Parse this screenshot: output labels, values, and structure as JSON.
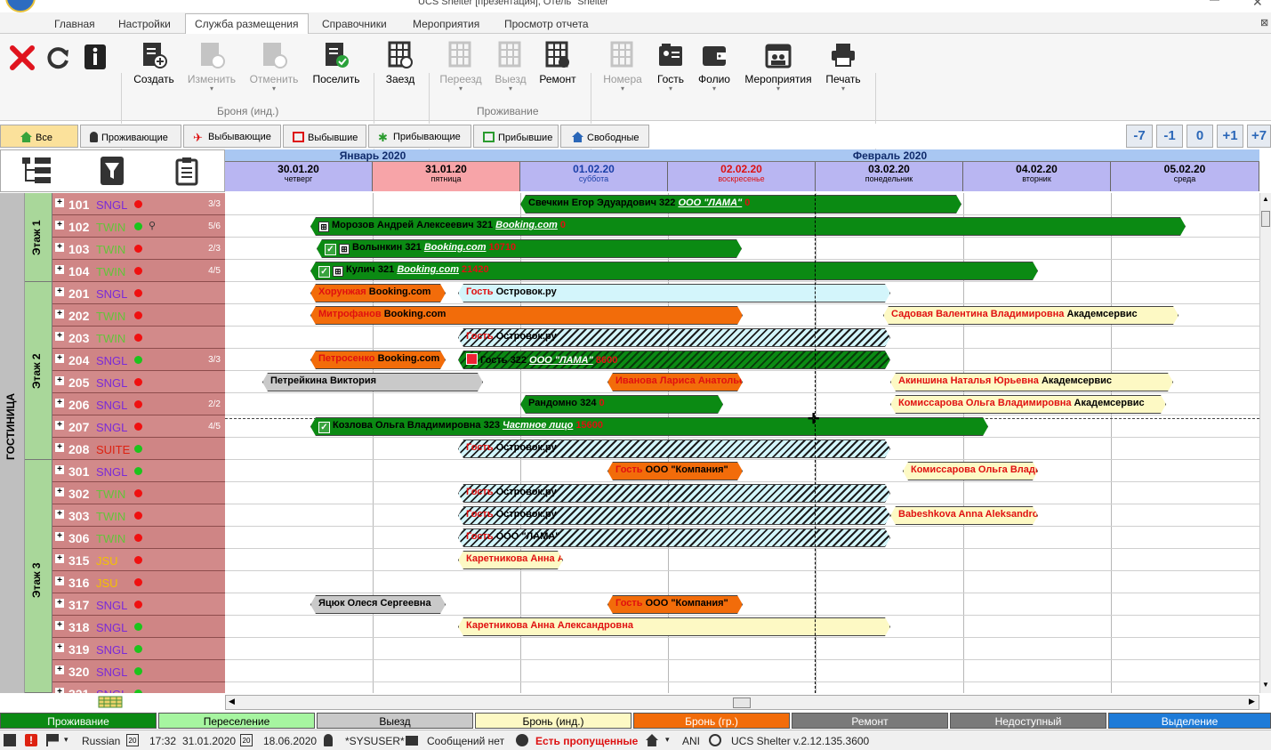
{
  "window": {
    "title": "UCS Shelter [презентация], Отель \"Shelter\""
  },
  "menu": {
    "items": [
      "Главная",
      "Настройки",
      "Служба размещения",
      "Справочники",
      "Мероприятия",
      "Просмотр отчета"
    ]
  },
  "ribbon": {
    "buttons": {
      "create": "Создать",
      "edit": "Изменить",
      "cancel": "Отменить",
      "settle": "Поселить",
      "checkin": "Заезд",
      "move": "Переезд",
      "checkout": "Выезд",
      "repair": "Ремонт",
      "rooms": "Номера",
      "guest": "Гость",
      "folio": "Фолио",
      "events": "Мероприятия",
      "print": "Печать"
    },
    "groups": {
      "booking": "Броня (инд.)",
      "living": "Проживание"
    }
  },
  "filters": {
    "all": "Все",
    "living": "Проживающие",
    "departing": "Выбывающие",
    "departed": "Выбывшие",
    "arriving": "Прибывающие",
    "arrived": "Прибывшие",
    "free": "Свободные"
  },
  "nav": [
    "-7",
    "-1",
    "0",
    "+1",
    "+7"
  ],
  "calendar": {
    "months": [
      "Январь 2020",
      "Февраль 2020"
    ],
    "days": [
      {
        "date": "30.01.20",
        "weekday": "четверг"
      },
      {
        "date": "31.01.20",
        "weekday": "пятница"
      },
      {
        "date": "01.02.20",
        "weekday": "суббота"
      },
      {
        "date": "02.02.20",
        "weekday": "воскресенье"
      },
      {
        "date": "03.02.20",
        "weekday": "понедельник"
      },
      {
        "date": "04.02.20",
        "weekday": "вторник"
      },
      {
        "date": "05.02.20",
        "weekday": "среда"
      }
    ]
  },
  "hotel": {
    "label": "ГОСТИНИЦА",
    "floors": [
      "Этаж 1",
      "Этаж 2",
      "Этаж 3"
    ]
  },
  "rooms": [
    {
      "num": "101",
      "type": "SNGL",
      "status": "red",
      "occ": "3/3"
    },
    {
      "num": "102",
      "type": "TWIN",
      "status": "green",
      "occ": "5/6"
    },
    {
      "num": "103",
      "type": "TWIN",
      "status": "red",
      "occ": "2/3"
    },
    {
      "num": "104",
      "type": "TWIN",
      "status": "red",
      "occ": "4/5"
    },
    {
      "num": "201",
      "type": "SNGL",
      "status": "red",
      "occ": ""
    },
    {
      "num": "202",
      "type": "TWIN",
      "status": "red",
      "occ": ""
    },
    {
      "num": "203",
      "type": "TWIN",
      "status": "red",
      "occ": ""
    },
    {
      "num": "204",
      "type": "SNGL",
      "status": "green",
      "occ": "3/3"
    },
    {
      "num": "205",
      "type": "SNGL",
      "status": "red",
      "occ": ""
    },
    {
      "num": "206",
      "type": "SNGL",
      "status": "red",
      "occ": "2/2"
    },
    {
      "num": "207",
      "type": "SNGL",
      "status": "red",
      "occ": "4/5"
    },
    {
      "num": "208",
      "type": "SUITE",
      "status": "green",
      "occ": ""
    },
    {
      "num": "301",
      "type": "SNGL",
      "status": "green",
      "occ": ""
    },
    {
      "num": "302",
      "type": "TWIN",
      "status": "red",
      "occ": ""
    },
    {
      "num": "303",
      "type": "TWIN",
      "status": "red",
      "occ": ""
    },
    {
      "num": "306",
      "type": "TWIN",
      "status": "red",
      "occ": ""
    },
    {
      "num": "315",
      "type": "JSU",
      "status": "red",
      "occ": ""
    },
    {
      "num": "316",
      "type": "JSU",
      "status": "red",
      "occ": ""
    },
    {
      "num": "317",
      "type": "SNGL",
      "status": "red",
      "occ": ""
    },
    {
      "num": "318",
      "type": "SNGL",
      "status": "green",
      "occ": ""
    },
    {
      "num": "319",
      "type": "SNGL",
      "status": "green",
      "occ": ""
    },
    {
      "num": "320",
      "type": "SNGL",
      "status": "green",
      "occ": ""
    },
    {
      "num": "321",
      "type": "SNGL",
      "status": "green",
      "occ": ""
    }
  ],
  "bookings": {
    "b101": {
      "name": "Свечкин Егор Эдуардович",
      "room": "322",
      "org": "ООО \"ЛАМА\"",
      "amount": "0"
    },
    "b102": {
      "name": "Морозов Андрей Алексеевич",
      "room": "321",
      "org": "Booking.com",
      "amount": "0"
    },
    "b103": {
      "name": "Волынкин",
      "room": "321",
      "org": "Booking.com",
      "amount": "10710"
    },
    "b104": {
      "name": "Кулич",
      "room": "321",
      "org": "Booking.com",
      "amount": "21420"
    },
    "b201a": {
      "name": "Хорунжая",
      "org": "Booking.com"
    },
    "b201b": {
      "name": "Гость",
      "org": "Островок.ру"
    },
    "b202a": {
      "name": "Митрофанов",
      "org": "Booking.com"
    },
    "b202b": {
      "name": "Садовая Валентина Владимировна",
      "org": "Академсервис"
    },
    "b203": {
      "name": "Гость",
      "org": "Островок.ру"
    },
    "b204a": {
      "name": "Петросенко",
      "org": "Booking.com"
    },
    "b204b": {
      "name": "Гость",
      "room": "322",
      "org": "ООО \"ЛАМА\"",
      "amount": "8600"
    },
    "b205a": {
      "name": "Петрейкина Виктория"
    },
    "b205b": {
      "name": "Иванова Лариса Анатольевна"
    },
    "b205c": {
      "name": "Акиншина Наталья Юрьевна",
      "org": "Академсервис"
    },
    "b206a": {
      "name": "Рандомно",
      "room": "324",
      "amount": "0"
    },
    "b206b": {
      "name": "Комиссарова Ольга Владимировна",
      "org": "Академсервис"
    },
    "b207": {
      "name": "Козлова Ольга Владимировна",
      "room": "323",
      "org": "Частное лицо",
      "amount": "15600"
    },
    "b208": {
      "name": "Гость",
      "org": "Островок.ру"
    },
    "b301a": {
      "name": "Гость",
      "org": "ООО \"Компания\""
    },
    "b301b": {
      "name": "Комиссарова Ольга Владимировна"
    },
    "b302": {
      "name": "Гость",
      "org": "Островок.ру"
    },
    "b303a": {
      "name": "Гость",
      "org": "Островок.ру"
    },
    "b303b": {
      "name": "Babeshkova Anna Aleksandrovna"
    },
    "b306": {
      "name": "Гость",
      "org": "ООО \"ЛАМА\""
    },
    "b315": {
      "name": "Каретникова  Анна Александровна"
    },
    "b317a": {
      "name": "Яцюк Олеся Сергеевна"
    },
    "b317b": {
      "name": "Гость",
      "org": "ООО \"Компания\""
    },
    "b318": {
      "name": "Каретникова  Анна Александровна"
    }
  },
  "legend": [
    {
      "label": "Проживание",
      "bg": "#0b8a13",
      "fg": "#ffffff"
    },
    {
      "label": "Переселение",
      "bg": "#a6f5a0",
      "fg": "#000000"
    },
    {
      "label": "Выезд",
      "bg": "#c9c9c9",
      "fg": "#000000"
    },
    {
      "label": "Бронь (инд.)",
      "bg": "#fdf9c4",
      "fg": "#000000"
    },
    {
      "label": "Бронь (гр.)",
      "bg": "#f26c0a",
      "fg": "#ffffff"
    },
    {
      "label": "Ремонт",
      "bg": "#7a7a7a",
      "fg": "#ffffff"
    },
    {
      "label": "Недоступный",
      "bg": "#7a7a7a",
      "fg": "#ffffff"
    },
    {
      "label": "Выделение",
      "bg": "#1e7bd8",
      "fg": "#ffffff"
    }
  ],
  "status": {
    "lang": "Russian",
    "time": "17:32",
    "date": "31.01.2020",
    "date2": "18.06.2020",
    "user": "*SYSUSER*",
    "messages": "Сообщений нет",
    "missed": "Есть пропущенные",
    "ani": "ANI",
    "version": "UCS Shelter v.2.12.135.3600",
    "cal_day": "20"
  }
}
